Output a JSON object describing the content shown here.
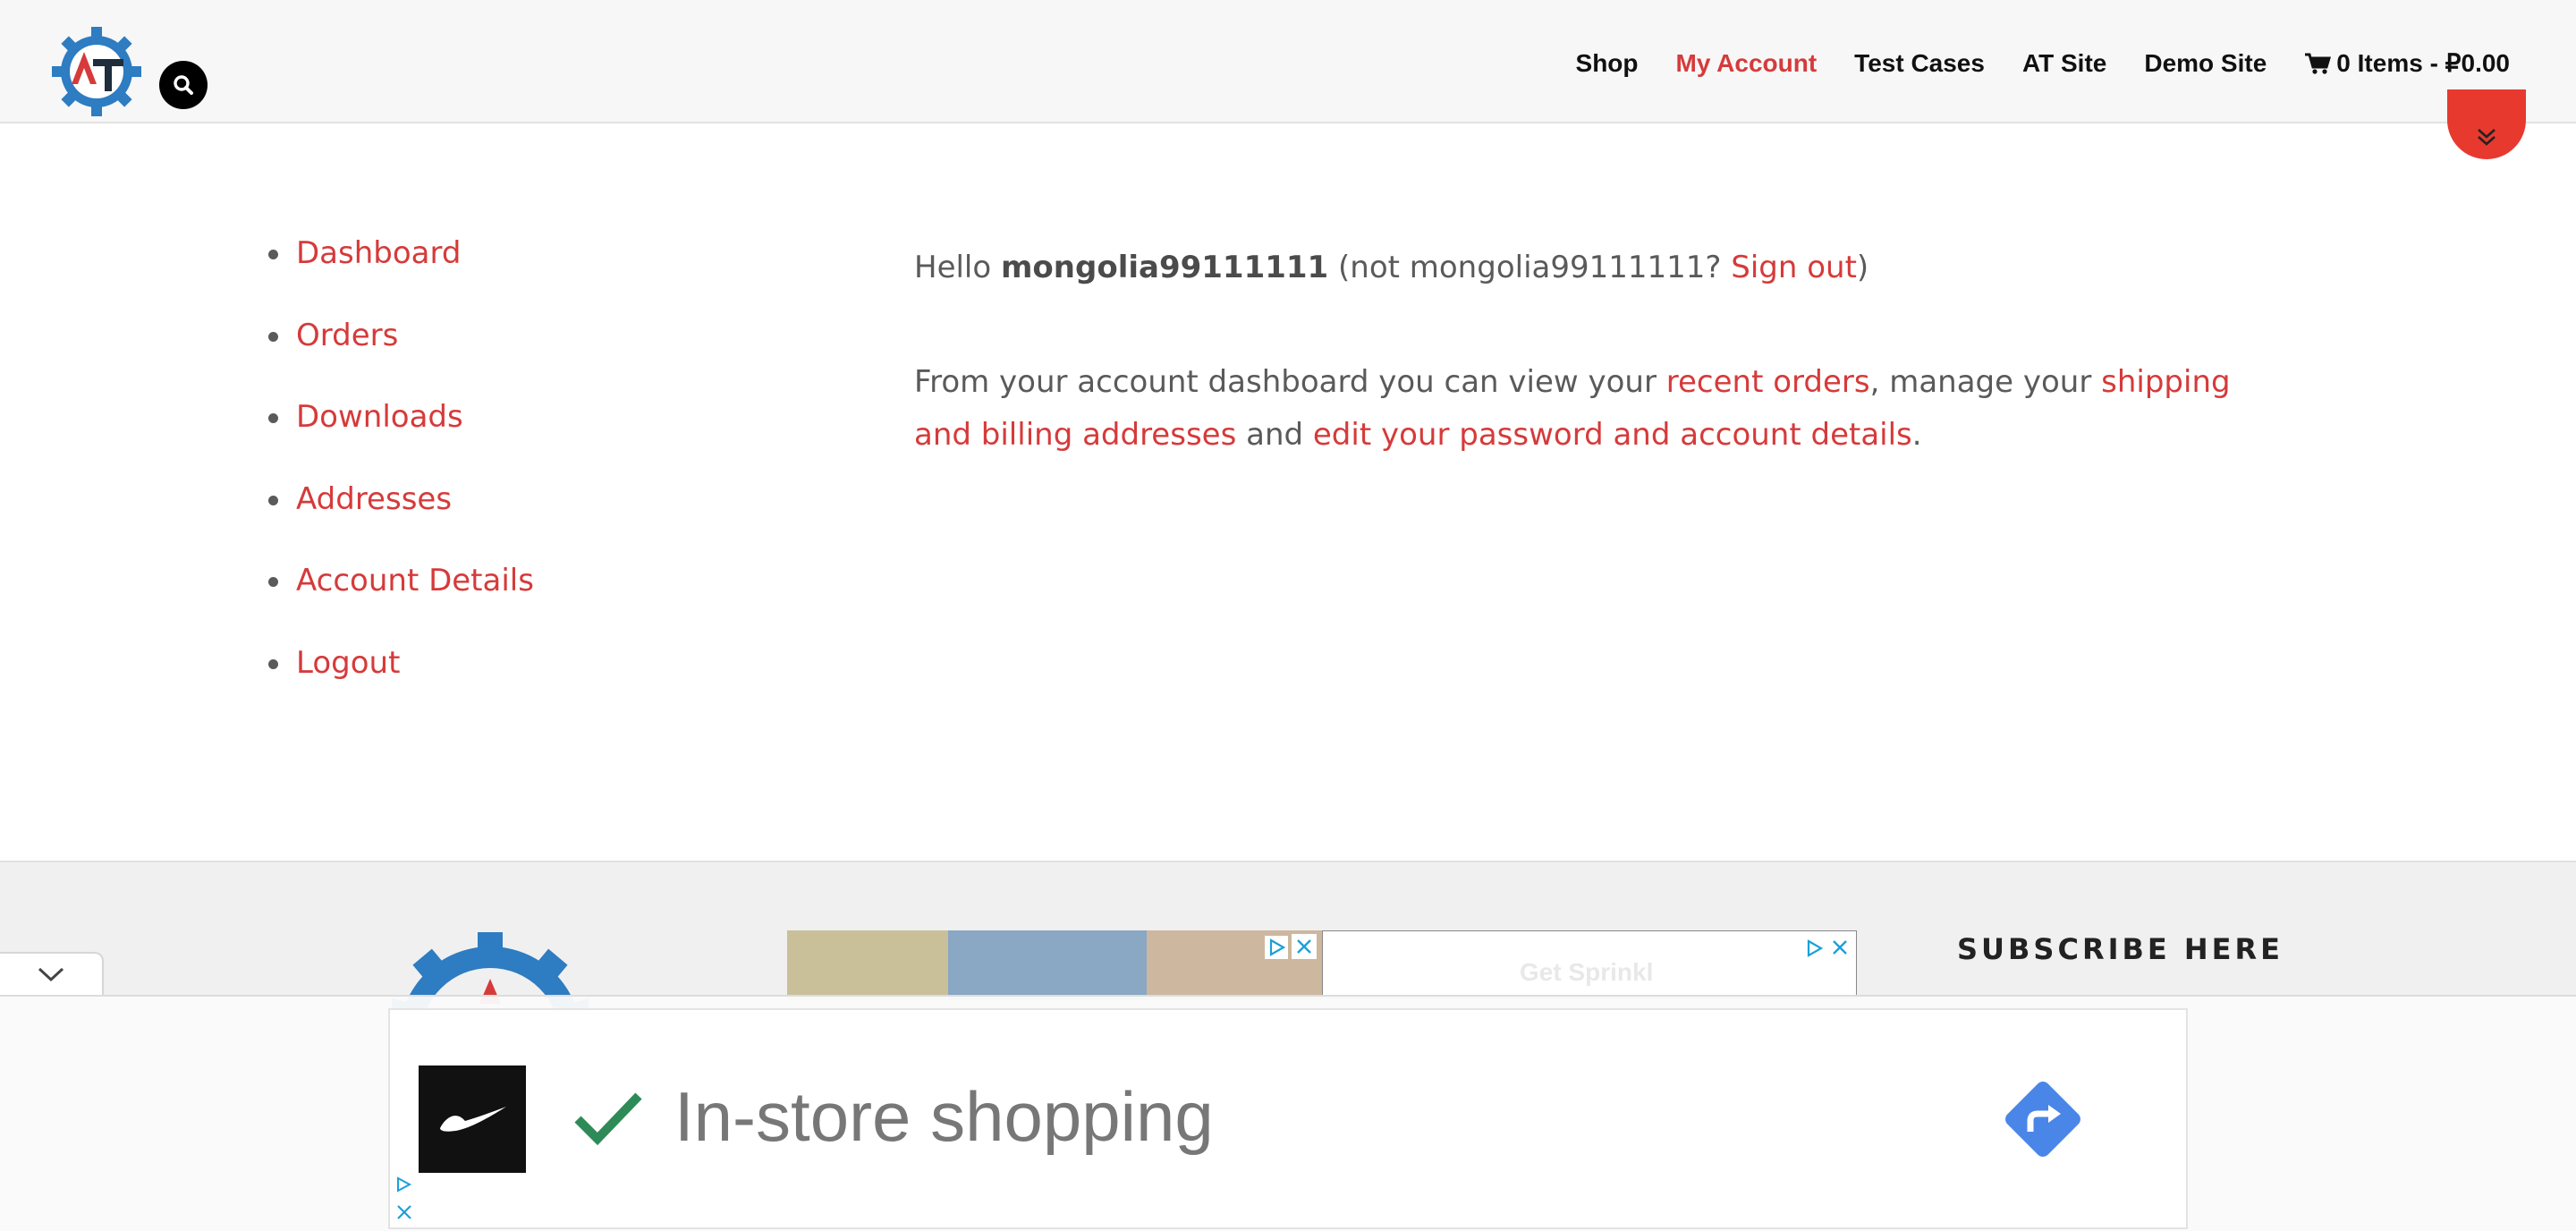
{
  "header": {
    "logo_alt": "AT",
    "nav": [
      {
        "label": "Shop",
        "active": false
      },
      {
        "label": "My Account",
        "active": true
      },
      {
        "label": "Test Cases",
        "active": false
      },
      {
        "label": "AT Site",
        "active": false
      },
      {
        "label": "Demo Site",
        "active": false
      }
    ],
    "cart_label": "0 Items - ₽0.00"
  },
  "account_nav": {
    "items": [
      "Dashboard",
      "Orders",
      "Downloads",
      "Addresses",
      "Account Details",
      "Logout"
    ]
  },
  "dashboard": {
    "hello_prefix": "Hello ",
    "username": "mongolia99111111",
    "not_prefix": " (not mongolia99111111? ",
    "sign_out": "Sign out",
    "not_suffix": ")",
    "desc_part1": "From your account dashboard you can view your ",
    "recent_orders_link": "recent orders",
    "desc_part2": ", manage your ",
    "addresses_link": "shipping and billing addresses",
    "desc_part3": " and ",
    "account_link": "edit your password and account details",
    "desc_part4": "."
  },
  "footer": {
    "subscribe_heading": "SUBSCRIBE HERE",
    "ad_ghost_text": "Get Sprinkl"
  },
  "sticky_ad": {
    "text": "In-store shopping",
    "brand_icon": "nike-swoosh-icon",
    "check_icon": "check-icon",
    "direction_icon": "directions-icon"
  },
  "colors": {
    "accent": "#d63a3a",
    "scroll_button": "#e8392f",
    "logo_blue": "#2e7cc1",
    "check_green": "#2e8b57",
    "directions_blue": "#4a86e8"
  }
}
